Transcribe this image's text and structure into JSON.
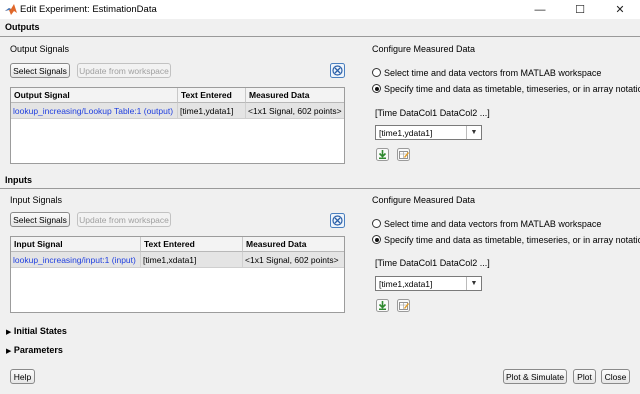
{
  "window": {
    "title": "Edit Experiment: EstimationData",
    "minimize_glyph": "—",
    "maximize_glyph": "☐",
    "close_glyph": "✕"
  },
  "outputs": {
    "section_label": "Outputs",
    "signals_label": "Output Signals",
    "select_button": "Select Signals",
    "update_button": "Update from workspace",
    "table": {
      "columns": [
        "Output Signal",
        "Text Entered",
        "Measured Data"
      ],
      "rows": [
        {
          "signal": "lookup_increasing/Lookup Table:1 (output)",
          "text": "[time1,ydata1]",
          "measured": "<1x1 Signal, 602 points>"
        }
      ]
    },
    "configure": {
      "title": "Configure Measured Data",
      "option_workspace": "Select time and data vectors from MATLAB workspace",
      "option_specify": "Specify time and data as timetable, timeseries, or in array notation",
      "selected_option": "specify",
      "columns_label": "[Time DataCol1 DataCol2 ...]",
      "dropdown_value": "[time1,ydata1]"
    }
  },
  "inputs": {
    "section_label": "Inputs",
    "signals_label": "Input Signals",
    "select_button": "Select Signals",
    "update_button": "Update from workspace",
    "table": {
      "columns": [
        "Input Signal",
        "Text Entered",
        "Measured Data"
      ],
      "rows": [
        {
          "signal": "lookup_increasing/input:1 (input)",
          "text": "[time1,xdata1]",
          "measured": "<1x1 Signal, 602 points>"
        }
      ]
    },
    "configure": {
      "title": "Configure Measured Data",
      "option_workspace": "Select time and data vectors from MATLAB workspace",
      "option_specify": "Specify time and data as timetable, timeseries, or in array notation",
      "selected_option": "specify",
      "columns_label": "[Time DataCol1 DataCol2 ...]",
      "dropdown_value": "[time1,xdata1]"
    }
  },
  "collapsed_sections": {
    "initial_states": "Initial States",
    "parameters": "Parameters"
  },
  "footer": {
    "help": "Help",
    "plot_simulate": "Plot & Simulate",
    "plot": "Plot",
    "close": "Close"
  },
  "colors": {
    "link": "#1f3fe0",
    "matlab_icon": "#e0682a"
  },
  "icons": {
    "app": "matlab-logo-icon",
    "delete": "delete-signal-icon",
    "import": "import-data-icon",
    "edit": "edit-data-icon"
  }
}
